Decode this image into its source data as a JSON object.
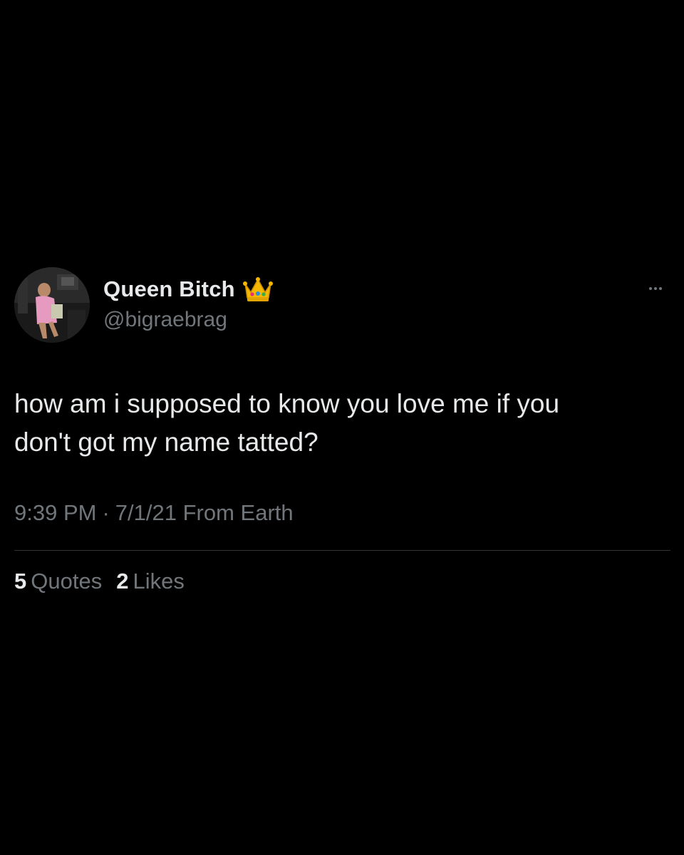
{
  "user": {
    "display_name": "Queen Bitch",
    "handle": "@bigraebrag",
    "badge_icon": "crown-emoji-icon"
  },
  "tweet": {
    "text": "how am i supposed to know you love me if you\ndon't got my name tatted?",
    "time": "9:39 PM",
    "separator": "·",
    "date": "7/1/21",
    "source": "From Earth"
  },
  "stats": {
    "quotes_count": "5",
    "quotes_label": "Quotes",
    "likes_count": "2",
    "likes_label": "Likes"
  },
  "icons": {
    "more": "more-horizontal-icon",
    "avatar": "profile-photo"
  },
  "colors": {
    "background": "#000000",
    "primary_text": "#e7e9ea",
    "secondary_text": "#71767b",
    "divider": "#2f3336"
  }
}
